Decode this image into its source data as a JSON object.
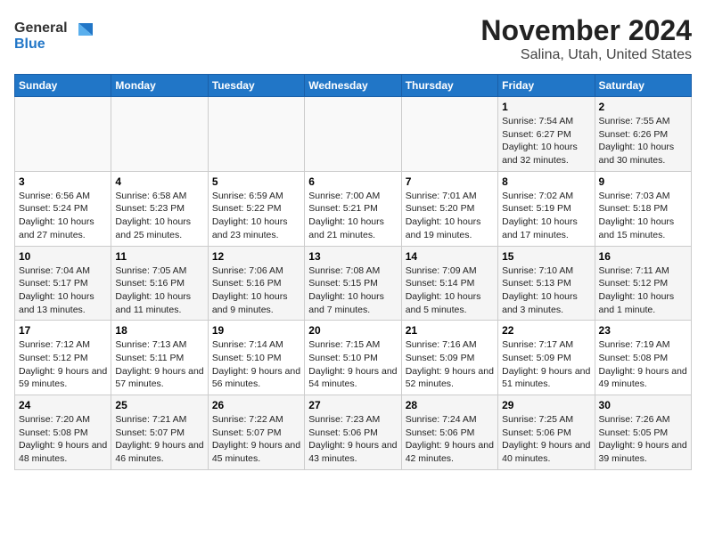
{
  "header": {
    "logo_line1": "General",
    "logo_line2": "Blue",
    "title": "November 2024",
    "subtitle": "Salina, Utah, United States"
  },
  "weekdays": [
    "Sunday",
    "Monday",
    "Tuesday",
    "Wednesday",
    "Thursday",
    "Friday",
    "Saturday"
  ],
  "weeks": [
    [
      {
        "day": "",
        "info": ""
      },
      {
        "day": "",
        "info": ""
      },
      {
        "day": "",
        "info": ""
      },
      {
        "day": "",
        "info": ""
      },
      {
        "day": "",
        "info": ""
      },
      {
        "day": "1",
        "info": "Sunrise: 7:54 AM\nSunset: 6:27 PM\nDaylight: 10 hours and 32 minutes."
      },
      {
        "day": "2",
        "info": "Sunrise: 7:55 AM\nSunset: 6:26 PM\nDaylight: 10 hours and 30 minutes."
      }
    ],
    [
      {
        "day": "3",
        "info": "Sunrise: 6:56 AM\nSunset: 5:24 PM\nDaylight: 10 hours and 27 minutes."
      },
      {
        "day": "4",
        "info": "Sunrise: 6:58 AM\nSunset: 5:23 PM\nDaylight: 10 hours and 25 minutes."
      },
      {
        "day": "5",
        "info": "Sunrise: 6:59 AM\nSunset: 5:22 PM\nDaylight: 10 hours and 23 minutes."
      },
      {
        "day": "6",
        "info": "Sunrise: 7:00 AM\nSunset: 5:21 PM\nDaylight: 10 hours and 21 minutes."
      },
      {
        "day": "7",
        "info": "Sunrise: 7:01 AM\nSunset: 5:20 PM\nDaylight: 10 hours and 19 minutes."
      },
      {
        "day": "8",
        "info": "Sunrise: 7:02 AM\nSunset: 5:19 PM\nDaylight: 10 hours and 17 minutes."
      },
      {
        "day": "9",
        "info": "Sunrise: 7:03 AM\nSunset: 5:18 PM\nDaylight: 10 hours and 15 minutes."
      }
    ],
    [
      {
        "day": "10",
        "info": "Sunrise: 7:04 AM\nSunset: 5:17 PM\nDaylight: 10 hours and 13 minutes."
      },
      {
        "day": "11",
        "info": "Sunrise: 7:05 AM\nSunset: 5:16 PM\nDaylight: 10 hours and 11 minutes."
      },
      {
        "day": "12",
        "info": "Sunrise: 7:06 AM\nSunset: 5:16 PM\nDaylight: 10 hours and 9 minutes."
      },
      {
        "day": "13",
        "info": "Sunrise: 7:08 AM\nSunset: 5:15 PM\nDaylight: 10 hours and 7 minutes."
      },
      {
        "day": "14",
        "info": "Sunrise: 7:09 AM\nSunset: 5:14 PM\nDaylight: 10 hours and 5 minutes."
      },
      {
        "day": "15",
        "info": "Sunrise: 7:10 AM\nSunset: 5:13 PM\nDaylight: 10 hours and 3 minutes."
      },
      {
        "day": "16",
        "info": "Sunrise: 7:11 AM\nSunset: 5:12 PM\nDaylight: 10 hours and 1 minute."
      }
    ],
    [
      {
        "day": "17",
        "info": "Sunrise: 7:12 AM\nSunset: 5:12 PM\nDaylight: 9 hours and 59 minutes."
      },
      {
        "day": "18",
        "info": "Sunrise: 7:13 AM\nSunset: 5:11 PM\nDaylight: 9 hours and 57 minutes."
      },
      {
        "day": "19",
        "info": "Sunrise: 7:14 AM\nSunset: 5:10 PM\nDaylight: 9 hours and 56 minutes."
      },
      {
        "day": "20",
        "info": "Sunrise: 7:15 AM\nSunset: 5:10 PM\nDaylight: 9 hours and 54 minutes."
      },
      {
        "day": "21",
        "info": "Sunrise: 7:16 AM\nSunset: 5:09 PM\nDaylight: 9 hours and 52 minutes."
      },
      {
        "day": "22",
        "info": "Sunrise: 7:17 AM\nSunset: 5:09 PM\nDaylight: 9 hours and 51 minutes."
      },
      {
        "day": "23",
        "info": "Sunrise: 7:19 AM\nSunset: 5:08 PM\nDaylight: 9 hours and 49 minutes."
      }
    ],
    [
      {
        "day": "24",
        "info": "Sunrise: 7:20 AM\nSunset: 5:08 PM\nDaylight: 9 hours and 48 minutes."
      },
      {
        "day": "25",
        "info": "Sunrise: 7:21 AM\nSunset: 5:07 PM\nDaylight: 9 hours and 46 minutes."
      },
      {
        "day": "26",
        "info": "Sunrise: 7:22 AM\nSunset: 5:07 PM\nDaylight: 9 hours and 45 minutes."
      },
      {
        "day": "27",
        "info": "Sunrise: 7:23 AM\nSunset: 5:06 PM\nDaylight: 9 hours and 43 minutes."
      },
      {
        "day": "28",
        "info": "Sunrise: 7:24 AM\nSunset: 5:06 PM\nDaylight: 9 hours and 42 minutes."
      },
      {
        "day": "29",
        "info": "Sunrise: 7:25 AM\nSunset: 5:06 PM\nDaylight: 9 hours and 40 minutes."
      },
      {
        "day": "30",
        "info": "Sunrise: 7:26 AM\nSunset: 5:05 PM\nDaylight: 9 hours and 39 minutes."
      }
    ]
  ]
}
